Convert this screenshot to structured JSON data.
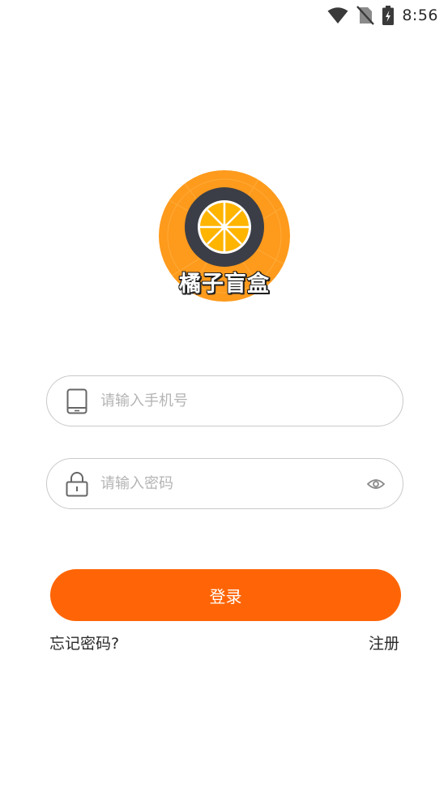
{
  "status_bar": {
    "time": "8:56",
    "icons": [
      "wifi-icon",
      "no-sim-icon",
      "battery-charging-icon"
    ]
  },
  "logo": {
    "text": "橘子盲盒",
    "icon": "orange-slice-icon",
    "colors": {
      "background": "#fe9a1c",
      "ring": "#3b3e46",
      "fruit": "#ffb400"
    }
  },
  "login_form": {
    "phone": {
      "icon": "phone-icon",
      "placeholder": "请输入手机号",
      "value": ""
    },
    "password": {
      "icon": "lock-icon",
      "placeholder": "请输入密码",
      "value": "",
      "toggle_icon": "eye-icon"
    },
    "submit_label": "登录",
    "forgot_label": "忘记密码?",
    "register_label": "注册"
  },
  "colors": {
    "accent": "#ff6506",
    "border": "#c9c9c9",
    "placeholder": "#b4b4b4"
  }
}
